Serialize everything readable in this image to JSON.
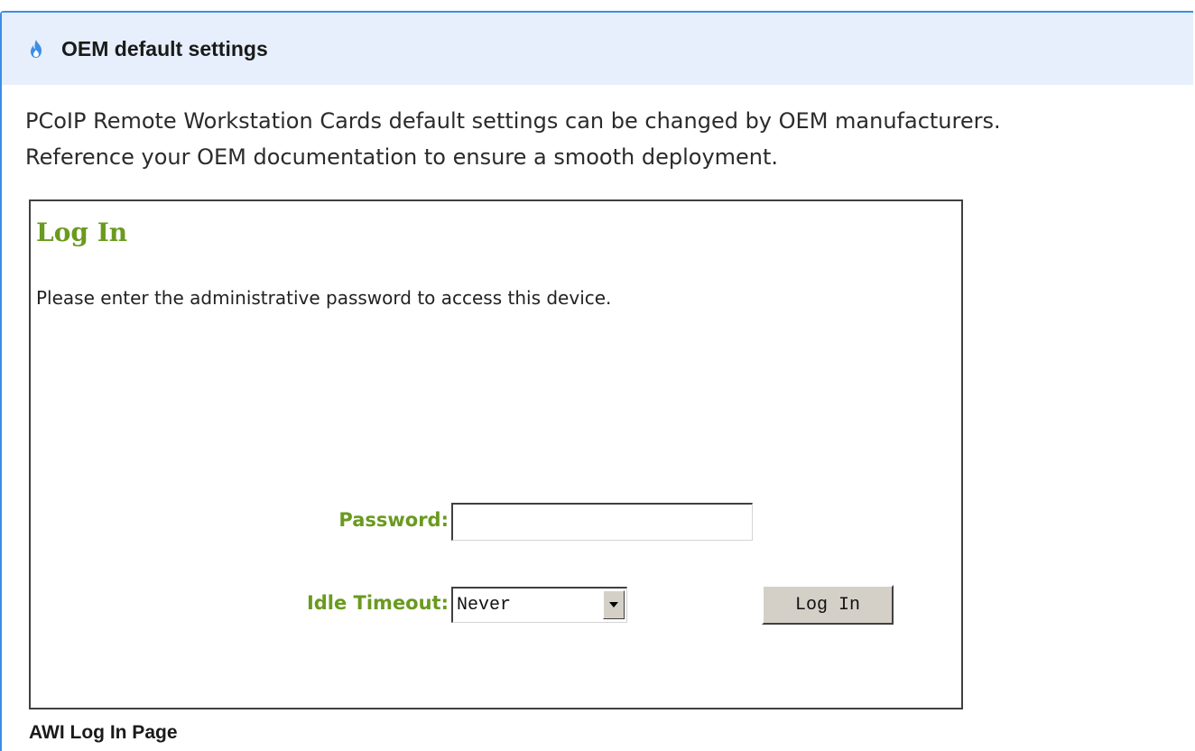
{
  "admonition": {
    "icon": "flame-icon",
    "title": "OEM default settings",
    "body_line1": "PCoIP Remote Workstation Cards default settings can be changed by OEM manufacturers.",
    "body_line2": "Reference your OEM documentation to ensure a smooth deployment.",
    "accent_color": "#3b8ee6",
    "header_bg": "#e6effb"
  },
  "login_screen": {
    "title": "Log In",
    "description": "Please enter the administrative password to access this device.",
    "password_label": "Password:",
    "password_value": "",
    "idle_timeout_label": "Idle Timeout:",
    "idle_timeout_value": "Never",
    "login_button_label": "Log In",
    "label_color": "#6a9a1f"
  },
  "caption": "AWI Log In Page"
}
